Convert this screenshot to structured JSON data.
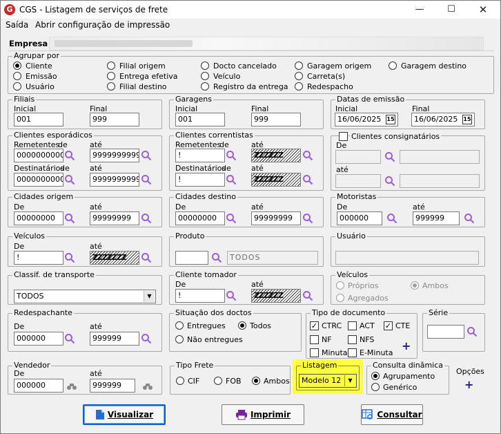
{
  "window": {
    "title": "CGS - Listagem de serviços de frete",
    "logo_letter": "G"
  },
  "menu": {
    "items": [
      "Saída",
      "Abrir configuração de impressão"
    ]
  },
  "empresa": {
    "label": "Empresa"
  },
  "agrupar": {
    "legend": "Agrupar por",
    "options": [
      "Cliente",
      "Emissão",
      "Usuário",
      "Filial origem",
      "Entrega efetiva",
      "Filial destino",
      "Docto cancelado",
      "Veículo",
      "Registro da entrega",
      "Garagem origem",
      "Carreta(s)",
      "Redespacho",
      "Garagem destino"
    ],
    "selected": "Cliente"
  },
  "filiais": {
    "legend": "Filiais",
    "label_initial": "Inicial",
    "label_final": "Final",
    "initial": "001",
    "final": "999"
  },
  "garagens": {
    "legend": "Garagens",
    "label_initial": "Inicial",
    "label_final": "Final",
    "initial": "001",
    "final": "999"
  },
  "datas": {
    "legend": "Datas de emissão",
    "label_initial": "Inicial",
    "label_final": "Final",
    "initial": "16/06/2025",
    "final": "16/06/2025",
    "cal_glyph": "15"
  },
  "esporadicos": {
    "legend": "Clientes esporádicos",
    "rem_label": "Remetentes",
    "de": "de",
    "ate": "até",
    "dest_label": "Destinatários",
    "rem_de": "00000000000",
    "rem_ate": "99999999999",
    "dest_de": "00000000000",
    "dest_ate": "99999999999"
  },
  "correntistas": {
    "legend": "Clientes correntistas",
    "rem_label": "Remetentes",
    "de": "de",
    "ate": "até",
    "dest_label": "Destinatários",
    "rem_de": "!",
    "rem_ate": "ZZZZZZ",
    "dest_de": "!",
    "dest_ate": "ZZZZZZ"
  },
  "consignatarios": {
    "label": "Clientes consignatários",
    "de": "De",
    "ate": "até"
  },
  "cidades_origem": {
    "legend": "Cidades origem",
    "de": "De",
    "ate": "até",
    "from": "00000000",
    "to": "99999999"
  },
  "cidades_destino": {
    "legend": "Cidades destino",
    "de": "De",
    "ate": "até",
    "from": "00000000",
    "to": "99999999"
  },
  "motoristas": {
    "legend": "Motoristas",
    "de": "De",
    "ate": "até",
    "from": "000000",
    "to": "999999"
  },
  "veiculos": {
    "legend": "Veículos",
    "de": "De",
    "ate": "até",
    "from": "!",
    "to": "ZZZZZZZ"
  },
  "produto": {
    "legend": "Produto",
    "value": "TODOS"
  },
  "usuario": {
    "legend": "Usuário"
  },
  "classif": {
    "legend": "Classif. de transporte",
    "value": "TODOS"
  },
  "tomador": {
    "legend": "Cliente tomador",
    "de": "De",
    "ate": "até",
    "from": "!",
    "to": "ZZZZZZ"
  },
  "veiculos_tipo": {
    "legend": "Veículos",
    "options": [
      "Próprios",
      "Ambos",
      "Agregados"
    ],
    "selected": "Ambos"
  },
  "redespachante": {
    "legend": "Redespachante",
    "de": "De",
    "ate": "até",
    "from": "000000",
    "to": "999999"
  },
  "situacao": {
    "legend": "Situação dos doctos",
    "options": [
      "Entregues",
      "Todos",
      "Não entregues"
    ],
    "selected": "Todos"
  },
  "tipo_doc": {
    "legend": "Tipo de documento",
    "options": [
      {
        "label": "CTRC",
        "checked": true
      },
      {
        "label": "ACT",
        "checked": false
      },
      {
        "label": "CTE",
        "checked": true
      },
      {
        "label": "NF",
        "checked": false
      },
      {
        "label": "NFS",
        "checked": false
      },
      {
        "label": "Minuta",
        "checked": false
      },
      {
        "label": "E-Minuta",
        "checked": false
      }
    ]
  },
  "serie": {
    "legend": "Série"
  },
  "vendedor": {
    "legend": "Vendedor",
    "de": "De",
    "ate": "até",
    "from": "000000",
    "to": "999999"
  },
  "tipo_frete": {
    "legend": "Tipo Frete",
    "options": [
      "CIF",
      "FOB",
      "Ambos"
    ],
    "selected": "Ambos"
  },
  "listagem": {
    "legend": "Listagem",
    "value": "Modelo 12",
    "highlight": "#ffff40"
  },
  "consulta": {
    "legend": "Consulta dinâmica",
    "options": [
      "Agrupamento",
      "Genérico"
    ],
    "selected": "Agrupamento"
  },
  "opcoes": {
    "label": "Opções"
  },
  "buttons": {
    "visualizar": "Visualizar",
    "imprimir": "Imprimir",
    "consultar": "Consultar"
  },
  "colors": {
    "accent": "#0a62c4",
    "magnifier": "#9c5fd6",
    "logo": "#c62828"
  }
}
